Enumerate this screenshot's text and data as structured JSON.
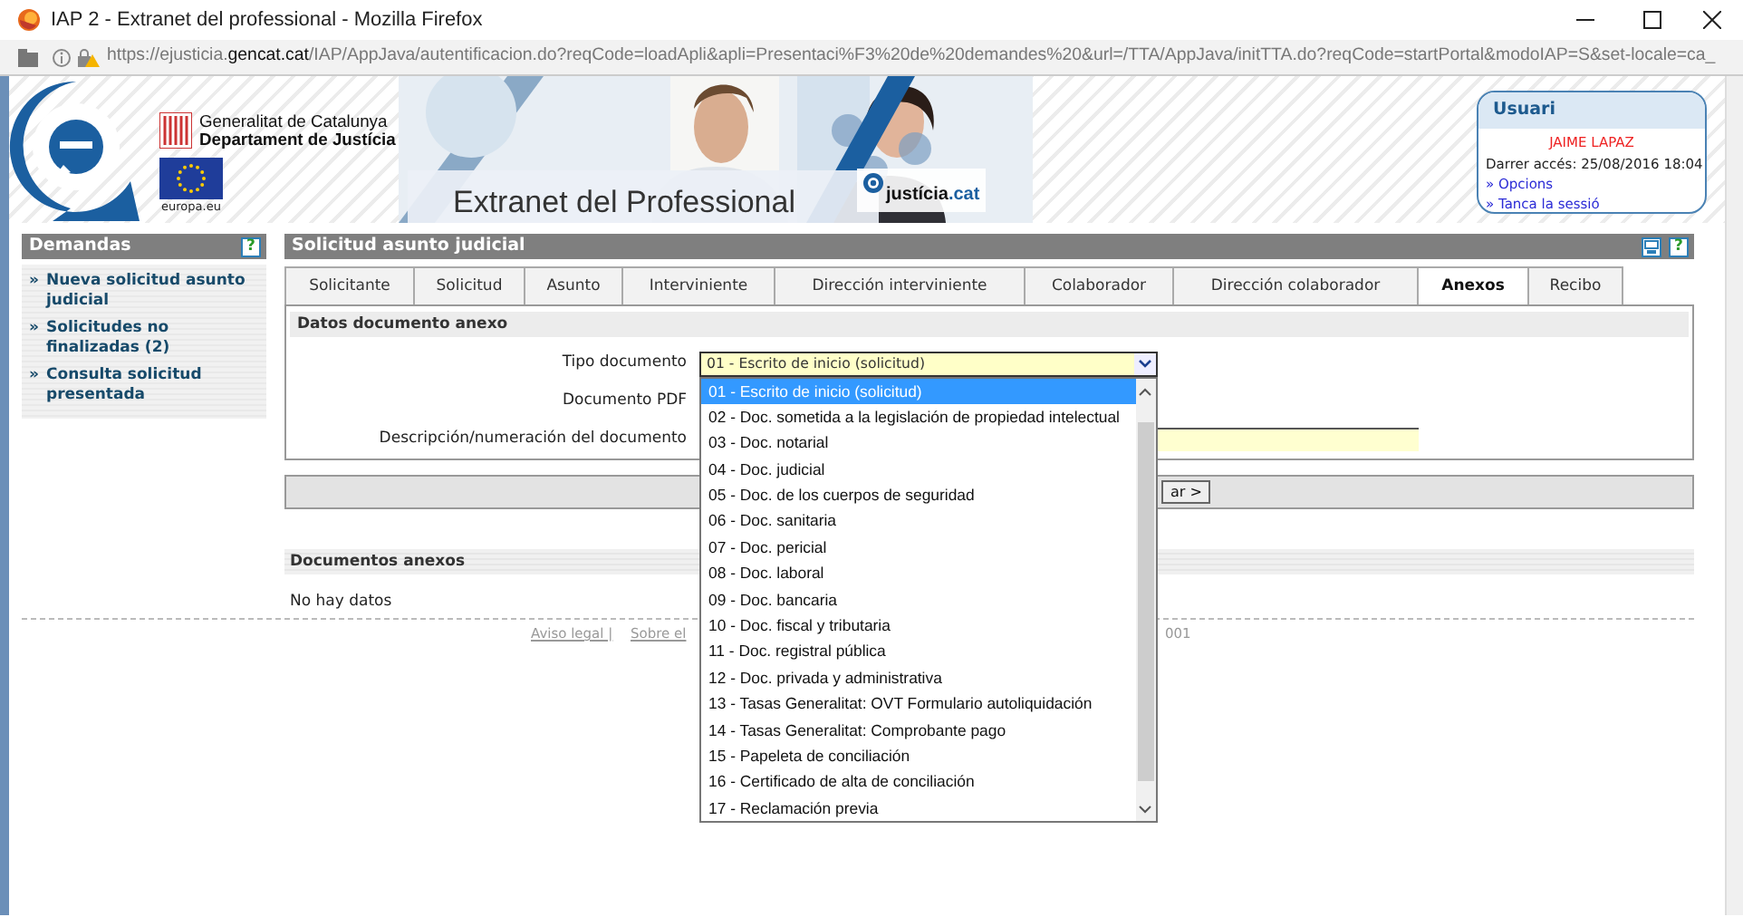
{
  "window": {
    "title": "IAP 2 - Extranet del professional - Mozilla Firefox"
  },
  "address_bar": {
    "url_start": "https://ejusticia.",
    "url_domain": "gencat.cat",
    "url_rest": "/IAP/AppJava/autentificacion.do?reqCode=loadApli&apli=Presentaci%F3%20de%20demandes%20&url=/TTA/AppJava/initTTA.do?reqCode=startPortal&modoIAP=S&set-locale=ca_"
  },
  "header": {
    "org_line1": "Generalitat de Catalunya",
    "org_line2": "Departament de Justícia",
    "eu_label": "europa.eu",
    "banner_title": "Extranet del Professional",
    "portal_name": "justícia",
    "portal_suffix": ".cat"
  },
  "user_box": {
    "title": "Usuari",
    "user_name": "JAIME LAPAZ",
    "last_access": "Darrer accés: 25/08/2016 18:04",
    "links": [
      {
        "marker": "»",
        "label": "Opcions"
      },
      {
        "marker": "»",
        "label": "Tanca la sessió"
      }
    ]
  },
  "sidebar": {
    "title": "Demandas",
    "help": "?",
    "items": [
      {
        "marker": "»",
        "label": "Nueva solicitud asunto judicial"
      },
      {
        "marker": "»",
        "label": "Solicitudes no finalizadas (2)"
      },
      {
        "marker": "»",
        "label": "Consulta solicitud presentada"
      }
    ]
  },
  "main": {
    "title": "Solicitud asunto judicial",
    "help": "?",
    "tabs": [
      {
        "label": "Solicitante",
        "selected": false
      },
      {
        "label": "Solicitud",
        "selected": false
      },
      {
        "label": "Asunto",
        "selected": false
      },
      {
        "label": "Interviniente",
        "selected": false
      },
      {
        "label": "Dirección interviniente",
        "selected": false
      },
      {
        "label": "Colaborador",
        "selected": false
      },
      {
        "label": "Dirección colaborador",
        "selected": false
      },
      {
        "label": "Anexos",
        "selected": true
      },
      {
        "label": "Recibo",
        "selected": false
      }
    ],
    "section_title": "Datos documento anexo",
    "fields": [
      {
        "kind": "select",
        "label": "Tipo documento",
        "value": "01 - Escrito de inicio (solicitud)"
      },
      {
        "kind": "file",
        "label": "Documento PDF"
      },
      {
        "kind": "text",
        "label": "Descripción/numeración del documento"
      }
    ],
    "button": "ar >",
    "documents_title": "Documentos anexos",
    "documents_empty": "No hay datos"
  },
  "dropdown": {
    "options": [
      {
        "label": "01 - Escrito de inicio (solicitud)",
        "selected": true
      },
      {
        "label": "02 - Doc. sometida a la legislación de propiedad intelectual",
        "selected": false
      },
      {
        "label": "03 - Doc. notarial",
        "selected": false
      },
      {
        "label": "04 - Doc. judicial",
        "selected": false
      },
      {
        "label": "05 - Doc. de los cuerpos de seguridad",
        "selected": false
      },
      {
        "label": "06 - Doc. sanitaria",
        "selected": false
      },
      {
        "label": "07 - Doc. pericial",
        "selected": false
      },
      {
        "label": "08 - Doc. laboral",
        "selected": false
      },
      {
        "label": "09 - Doc. bancaria",
        "selected": false
      },
      {
        "label": "10 - Doc. fiscal y tributaria",
        "selected": false
      },
      {
        "label": "11 - Doc. registral pública",
        "selected": false
      },
      {
        "label": "12 - Doc. privada y administrativa",
        "selected": false
      },
      {
        "label": "13 - Tasas Generalitat: OVT Formulario autoliquidación",
        "selected": false
      },
      {
        "label": "14 - Tasas Generalitat: Comprobante pago",
        "selected": false
      },
      {
        "label": "15 - Papeleta de conciliación",
        "selected": false
      },
      {
        "label": "16 - Certificado de alta de conciliación",
        "selected": false
      },
      {
        "label": "17 - Reclamación previa",
        "selected": false
      }
    ]
  },
  "footer": {
    "links": [
      "Aviso legal |",
      "Sobre el"
    ],
    "tail": "001"
  }
}
